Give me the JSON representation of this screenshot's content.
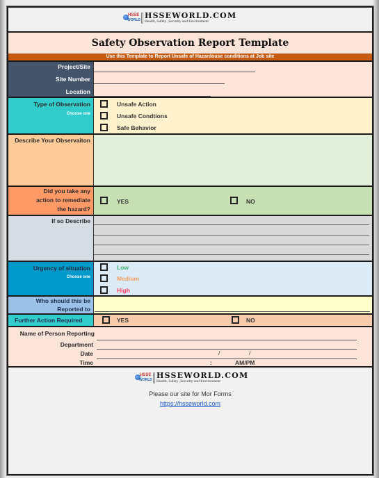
{
  "header": {
    "logo": {
      "badge_top": "HSSE",
      "badge_bottom": "WORLD",
      "brand": "HSSEWORLD.COM",
      "tagline": "Health, Safety ,Security and Environment"
    },
    "title": "Safety Observation Report Template",
    "subtitle": "Use this Template to Report Unsafe of Hazardouse conditions at Job site"
  },
  "project_section": {
    "fields": [
      {
        "label": "Project/Site",
        "value": ""
      },
      {
        "label": "Site Number",
        "value": ""
      },
      {
        "label": "Location",
        "value": ""
      }
    ]
  },
  "observation_type": {
    "label": "Type of Observation",
    "hint": "Choose one",
    "options": [
      {
        "label": "Unsafe Action",
        "checked": false
      },
      {
        "label": "Unsafe Condtions",
        "checked": false
      },
      {
        "label": "Safe Behavior",
        "checked": false
      }
    ]
  },
  "describe_observation": {
    "label": "Describe Your Observaiton",
    "value": ""
  },
  "remediation": {
    "label_lines": [
      "Did you take any",
      "action to remediate",
      "the hazard?"
    ],
    "yes_label": "YES",
    "no_label": "NO",
    "yes_checked": false,
    "no_checked": false
  },
  "if_so_describe": {
    "label": "If so Describe",
    "lines": [
      "",
      "",
      "",
      ""
    ]
  },
  "urgency": {
    "label": "Urgency of situation",
    "hint": "Choose one",
    "options": [
      {
        "label": "Low",
        "color": "#3cb371",
        "checked": false
      },
      {
        "label": "Medium",
        "color": "#f4a060",
        "checked": false
      },
      {
        "label": "High",
        "color": "#ff3b5c",
        "checked": false
      }
    ]
  },
  "reported_to": {
    "label_lines": [
      "Who should this be",
      "Reported to"
    ],
    "value": ""
  },
  "further_action": {
    "label": "Further Action Required",
    "yes_label": "YES",
    "no_label": "NO",
    "yes_checked": false,
    "no_checked": false
  },
  "reporter": {
    "name_label": "Name of Person Reporting",
    "department_label": "Department",
    "date_label": "Date",
    "time_label": "Time",
    "date_sep": "/",
    "time_sep": ":",
    "ampm": "AM/PM"
  },
  "footer": {
    "message": "Please our site for Mor Forms",
    "link": "https://hsseworld.com"
  },
  "colors": {
    "page_bg": "#f1f1f1",
    "title_band": "#fde4d8",
    "subtitle_bar": "#c55a11",
    "project_label_bg": "#44546a",
    "teal": "#33cccc",
    "cream": "#fff2cc",
    "peach": "#ffcc99",
    "light_green": "#e2efda",
    "orange": "#ff9966",
    "green": "#c6e0b4",
    "grey_blue": "#d6dce4",
    "grey": "#d9d9d9",
    "blue": "#0099cc",
    "pale_blue": "#ddebf7",
    "sky": "#9bc2e6",
    "pale_yellow": "#ffffcc",
    "salmon": "#f8cbad",
    "link": "#1a56c8"
  }
}
